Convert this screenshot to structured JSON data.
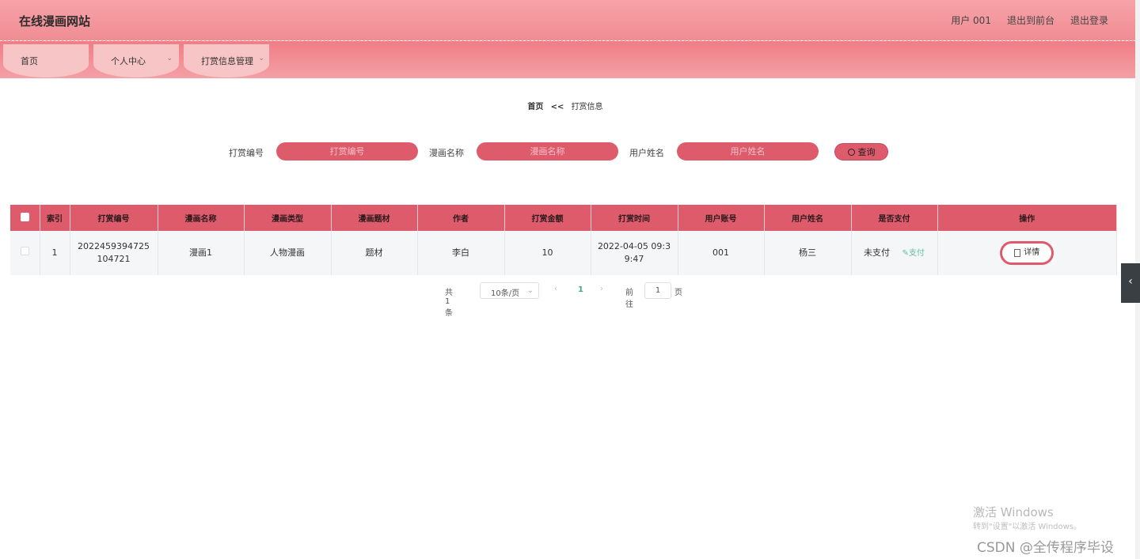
{
  "header": {
    "title": "在线漫画网站",
    "user": "用户 001",
    "back_front": "退出到前台",
    "logout": "退出登录"
  },
  "nav": {
    "home": "首页",
    "personal": "个人中心",
    "reward_mgmt": "打赏信息管理"
  },
  "breadcrumb": {
    "home": "首页",
    "sep": "<<",
    "current": "打赏信息"
  },
  "search": {
    "reward_no_label": "打赏编号",
    "reward_no_placeholder": "打赏编号",
    "comic_name_label": "漫画名称",
    "comic_name_placeholder": "漫画名称",
    "user_name_label": "用户姓名",
    "user_name_placeholder": "用户姓名",
    "query_label": "查询"
  },
  "table": {
    "headers": [
      "索引",
      "打赏编号",
      "漫画名称",
      "漫画类型",
      "漫画题材",
      "作者",
      "打赏金额",
      "打赏时间",
      "用户账号",
      "用户姓名",
      "是否支付",
      "操作"
    ],
    "rows": [
      {
        "index": "1",
        "reward_no": "2022459394725104721",
        "comic_name": "漫画1",
        "comic_type": "人物漫画",
        "theme": "题材",
        "author": "李白",
        "amount": "10",
        "time": "2022-04-05 09:39:47",
        "account": "001",
        "user_name": "杨三",
        "paid": "未支付",
        "pay_action": "支付",
        "detail": "详情"
      }
    ]
  },
  "pagination": {
    "total": "共 1 条",
    "page_size": "10条/页",
    "current": "1",
    "goto": "前往",
    "goto_value": "1",
    "page_suffix": "页"
  },
  "watermark": {
    "activate": "激活 Windows",
    "activate_hint": "转到\"设置\"以激活 Windows。",
    "csdn": "CSDN @全传程序毕设"
  }
}
